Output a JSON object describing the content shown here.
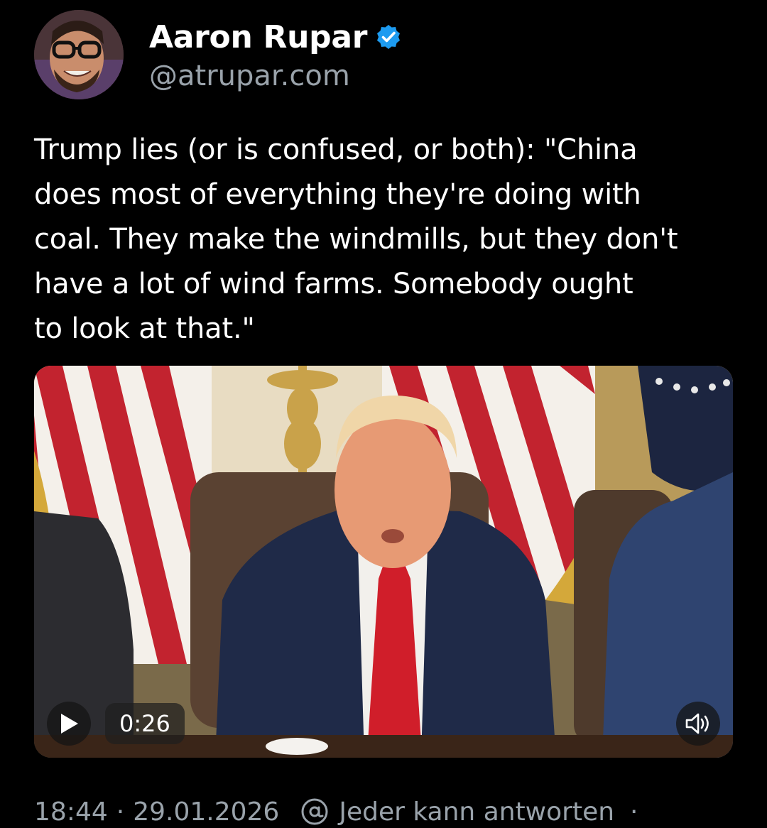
{
  "author": {
    "display_name": "Aaron Rupar",
    "handle": "@atrupar.com",
    "verified": true,
    "verified_color": "#1d9bf0"
  },
  "post": {
    "text": "Trump lies (or is confused, or both): \"China\ndoes most of everything they're doing with\ncoal. They make the windmills, but they don't\nhave a lot of wind farms. Somebody ought\nto look at that.\""
  },
  "video": {
    "duration": "0:26",
    "play_icon": "play-icon",
    "sound_icon": "speaker-icon"
  },
  "footer": {
    "time": "18:44",
    "separator": "·",
    "date": "29.01.2026",
    "reply_icon": "at-sign-icon",
    "reply_setting": "Jeder kann antworten",
    "trailing_separator": "·"
  },
  "colors": {
    "background": "#000000",
    "text_primary": "#ffffff",
    "text_secondary": "#9aa3ab"
  }
}
